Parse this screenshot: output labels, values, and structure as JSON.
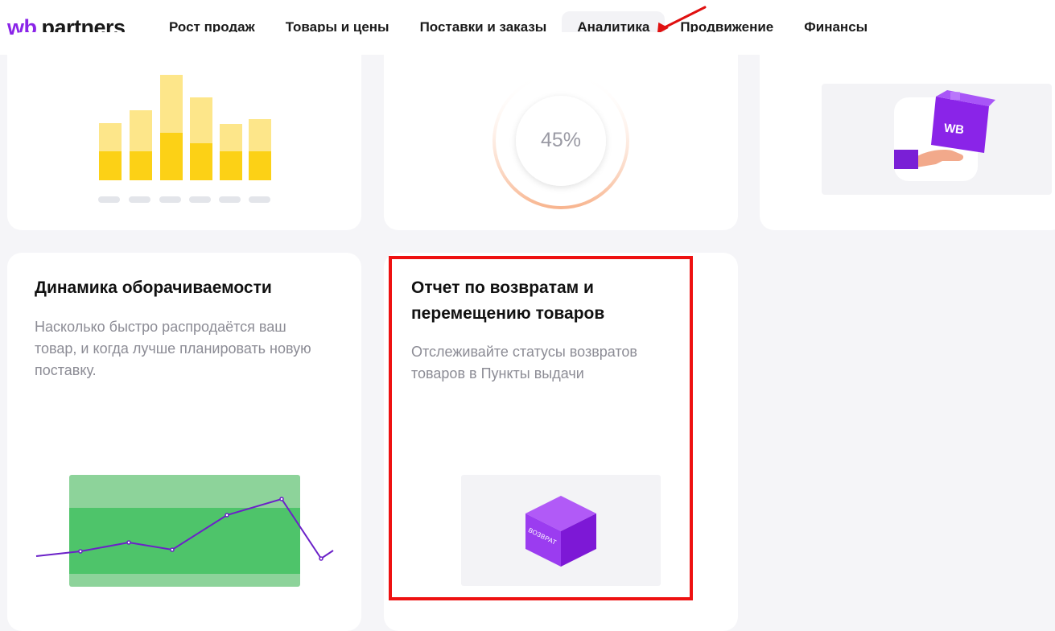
{
  "header": {
    "logo_wb": "wb",
    "logo_partners": "partners",
    "nav": [
      {
        "label": "Рост продаж",
        "active": false
      },
      {
        "label": "Товары и цены",
        "active": false
      },
      {
        "label": "Поставки и заказы",
        "active": false
      },
      {
        "label": "Аналитика",
        "active": true
      },
      {
        "label": "Продвижение",
        "active": false
      },
      {
        "label": "Финансы",
        "active": false
      }
    ]
  },
  "cards_top": {
    "percent_widget": {
      "value_label": "45%",
      "progress_percent": 45
    },
    "box_badge": "WB"
  },
  "cards": [
    {
      "title": "Динамика оборачиваемости",
      "description": "Насколько быстро распродаётся ваш товар, и когда лучше планировать новую поставку."
    },
    {
      "title": "Отчет по возвратам и перемещению товаров",
      "description": "Отслеживайте статусы возвратов товаров в Пункты выдачи",
      "box_label": "ВОЗВРАТ"
    }
  ],
  "colors": {
    "brand": "#8a24e8",
    "highlight": "#ee1111",
    "bar_light": "#fde68a",
    "bar_dark": "#fcd116",
    "chart_green": "#4ec46a",
    "chart_line": "#6b21c8"
  }
}
